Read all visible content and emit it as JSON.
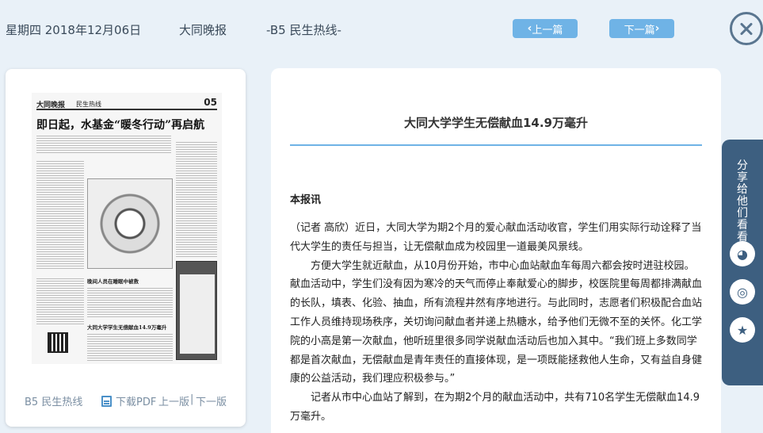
{
  "header": {
    "date": "星期四 2018年12月06日",
    "paper": "大同晚报",
    "page": "-B5 民生热线-",
    "prev_label": "上一篇",
    "next_label": "下一篇",
    "prev_chevron": "‹",
    "next_chevron": "›"
  },
  "thumbnail": {
    "logo": "大同晚报",
    "section": "民生热线",
    "page_number": "05",
    "headline": "即日起，水基金“暖冬行动”再启航",
    "sub_headline_1": "晚间人员在睡眠中被救",
    "sub_headline_2": "大同大学学生无偿献血14.9万毫升"
  },
  "left_footer": {
    "page_label": "B5 民生热线",
    "pdf_label": "下载PDF",
    "prev_page": "上一版",
    "separator": "|",
    "next_page": "下一版"
  },
  "article": {
    "title": "大同大学学生无偿献血14.9万毫升",
    "lead": "本报讯",
    "paragraphs": [
      "（记者 高欣）近日，大同大学为期2个月的爱心献血活动收官，学生们用实际行动诠释了当代大学生的责任与担当，让无偿献血成为校园里一道最美风景线。",
      "　　方便大学生就近献血，从10月份开始，市中心血站献血车每周六都会按时进驻校园。献血活动中，学生们没有因为寒冷的天气而停止奉献爱心的脚步，校医院里每周都排满献血的长队，填表、化验、抽血，所有流程井然有序地进行。与此同时，志愿者们积极配合血站工作人员维持现场秩序，关切询问献血者并递上热糖水，给予他们无微不至的关怀。化工学院的小高是第一次献血，他听班里很多同学说献血活动后也加入其中。“我们班上多数同学都是首次献血，无偿献血是青年责任的直接体现，是一项既能拯救他人生命，又有益自身健康的公益活动，我们理应积极参与。”",
      "　　记者从市中心血站了解到，在为期2个月的献血活动中，共有710名学生无偿献血14.9万毫升。"
    ]
  },
  "share": {
    "label": "分享给他们看看",
    "wechat_glyph": "◕",
    "weibo_glyph": "◎",
    "favorite_glyph": "★"
  }
}
